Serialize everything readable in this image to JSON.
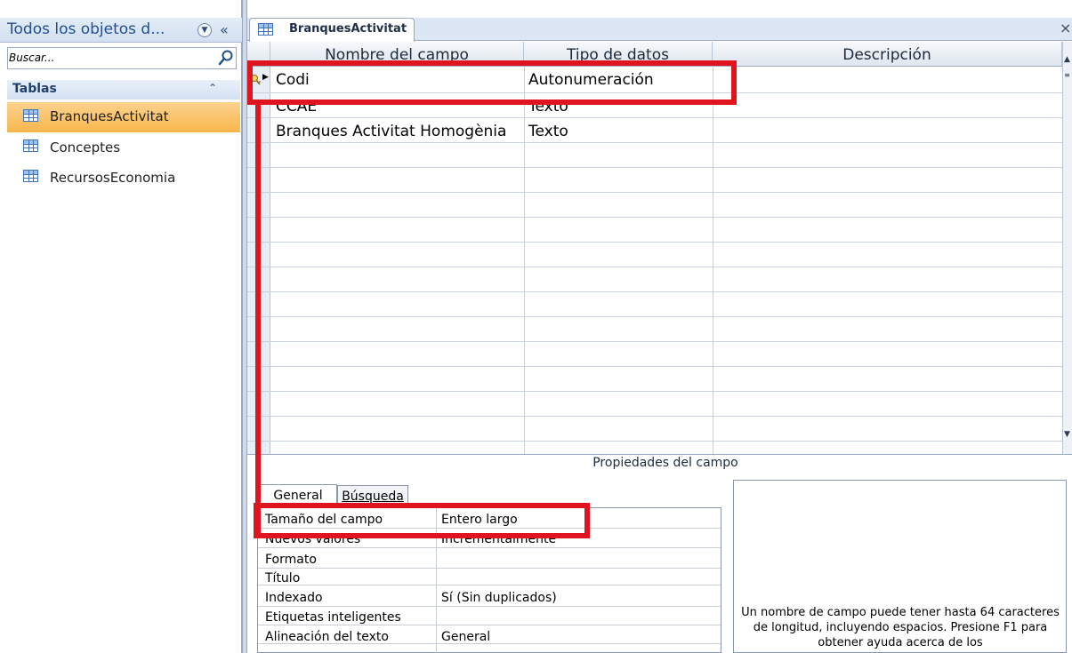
{
  "navigation_pane": {
    "title": "Todos los objetos d...",
    "menu_glyph": "▼",
    "collapse_glyph": "«",
    "search": {
      "placeholder": "Buscar..."
    },
    "group": {
      "title": "Tablas",
      "collapse_glyph": "⌃"
    },
    "items": [
      {
        "label": "BranquesActivitat",
        "selected": true
      },
      {
        "label": "Conceptes",
        "selected": false
      },
      {
        "label": "RecursosEconomia",
        "selected": false
      }
    ]
  },
  "document": {
    "tab_label": "BranquesActivitat",
    "close_glyph": "×",
    "columns": [
      "Nombre del campo",
      "Tipo de datos",
      "Descripción"
    ],
    "rows": [
      {
        "name": "Codi",
        "type": "Autonumeración",
        "description": "",
        "primary_key": true
      },
      {
        "name": "CCAE",
        "type": "Texto",
        "description": ""
      },
      {
        "name": "Branques Activitat Homogènia",
        "type": "Texto",
        "description": ""
      }
    ],
    "row_selector_glyph": "▶"
  },
  "field_properties": {
    "title": "Propiedades del campo",
    "tabs": [
      "General",
      "Búsqueda"
    ],
    "active_tab": "General",
    "properties": [
      {
        "label": "Tamaño del campo",
        "value": "Entero largo"
      },
      {
        "label": "Nuevos valores",
        "value": "Incrementalmente"
      },
      {
        "label": "Formato",
        "value": ""
      },
      {
        "label": "Título",
        "value": ""
      },
      {
        "label": "Indexado",
        "value": "Sí (Sin duplicados)"
      },
      {
        "label": "Etiquetas inteligentes",
        "value": ""
      },
      {
        "label": "Alineación del texto",
        "value": "General"
      }
    ],
    "help_text": "Un nombre de campo puede tener hasta 64 caracteres de longitud, incluyendo espacios. Presione F1 para obtener ayuda acerca de los"
  },
  "annotations": {
    "highlight_color": "#e0141e"
  }
}
